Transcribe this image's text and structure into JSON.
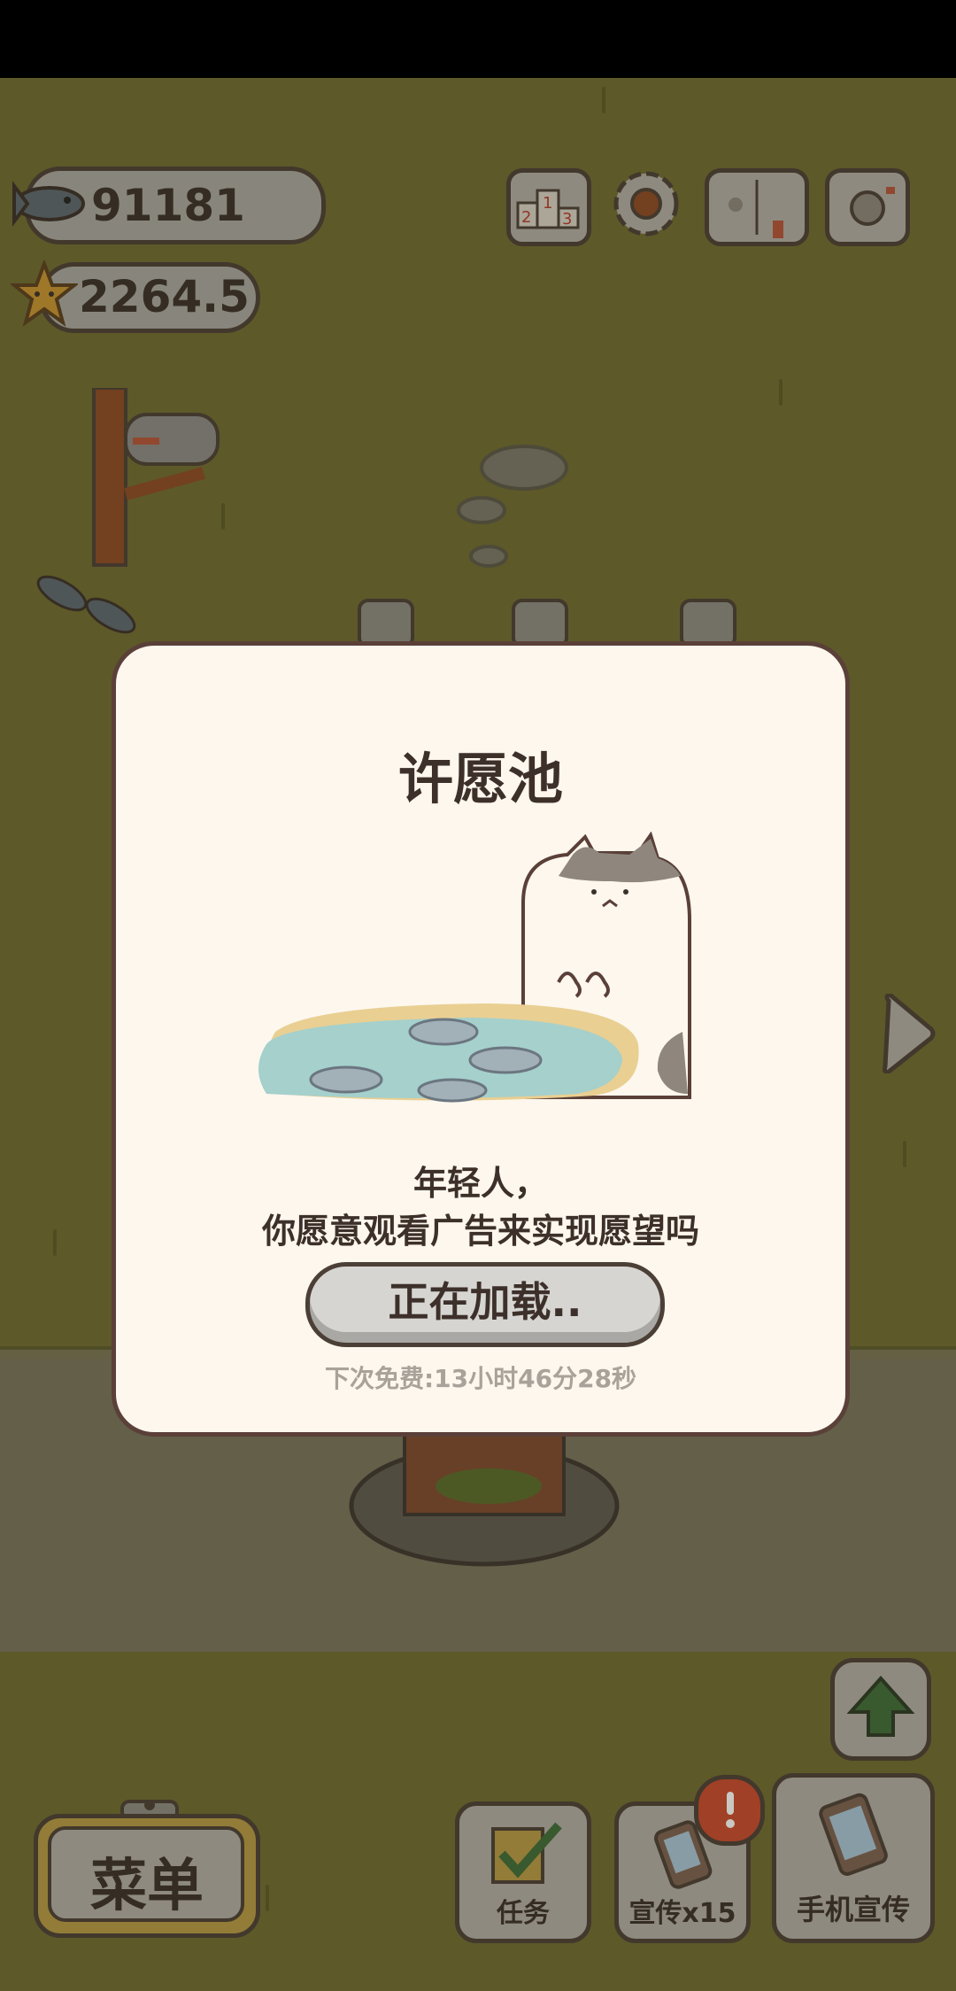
{
  "resources": {
    "fish": "91181",
    "stars": "2264.5"
  },
  "top_icons": [
    "ranking-icon",
    "gear-icon",
    "catbook-icon",
    "camera-icon"
  ],
  "modal": {
    "title": "许愿池",
    "line1": "年轻人，",
    "line2": "你愿意观看广告来实现愿望吗",
    "button": "正在加载..",
    "free_timer": "下次免费:13小时46分28秒"
  },
  "bottom": {
    "menu": "菜单",
    "tasks": "任务",
    "promo": "宣传x15",
    "phone_promo": "手机宣传"
  },
  "colors": {
    "grass": "#6f6b32",
    "modal_bg": "#fdf7ee",
    "modal_border": "#5a4038",
    "text_dark": "#3d302a",
    "pond_water": "#a5d0cc",
    "alert_badge": "#c84a2e"
  }
}
